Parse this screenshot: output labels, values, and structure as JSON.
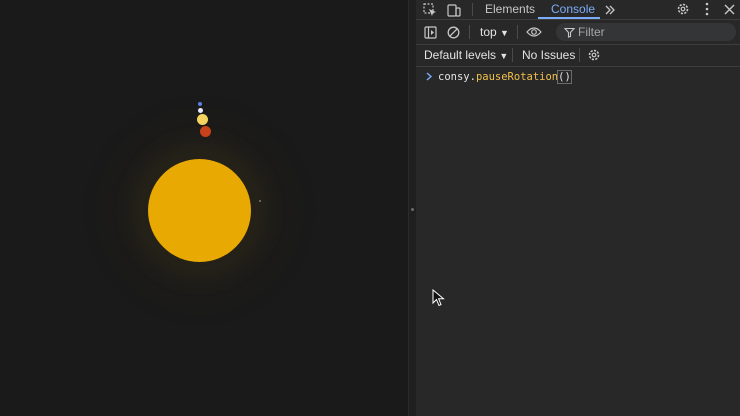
{
  "devtools": {
    "tabs": [
      {
        "label": "Elements",
        "active": false
      },
      {
        "label": "Console",
        "active": true
      }
    ],
    "toolbar": {
      "context": "top",
      "filter_placeholder": "Filter"
    },
    "levels": {
      "levels_label": "Default levels",
      "issues_label": "No Issues"
    },
    "console": {
      "input": {
        "object": "consy",
        "dot": ".",
        "method": "pauseRotation",
        "parens": "()"
      }
    },
    "icons": [
      "inspect-element-icon",
      "device-toolbar-icon",
      "more-tabs-icon",
      "settings-icon",
      "kebab-menu-icon",
      "close-icon",
      "sidebar-toggle-icon",
      "clear-console-icon",
      "dropdown-arrow-icon",
      "eye-icon",
      "filter-icon",
      "gear-icon",
      "prompt-chevron-icon"
    ]
  },
  "page": {
    "colors": {
      "sun": "#e8a903",
      "planet_blue": "#5b7fe0",
      "planet_white": "#e8e8ff",
      "planet_yellow": "#f4d35e",
      "planet_red": "#c9411a",
      "accent": "#7cacf8"
    }
  }
}
